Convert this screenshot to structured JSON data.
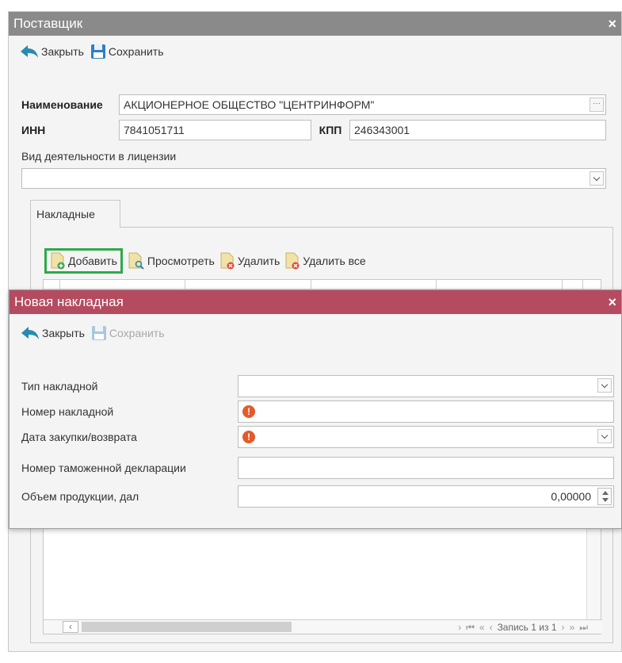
{
  "supplier_window": {
    "title": "Поставщик",
    "close_glyph": "×",
    "toolbar": {
      "close_label": "Закрыть",
      "save_label": "Сохранить"
    },
    "fields": {
      "name_label": "Наименование",
      "name_value": "АКЦИОНЕРНОЕ ОБЩЕСТВО \"ЦЕНТРИНФОРМ\"",
      "inn_label": "ИНН",
      "inn_value": "7841051711",
      "kpp_label": "КПП",
      "kpp_value": "246343001",
      "activity_label": "Вид деятельности в лицензии",
      "activity_value": ""
    },
    "tab_label": "Накладные",
    "grid_toolbar": {
      "add_label": "Добавить",
      "view_label": "Просмотреть",
      "delete_label": "Удалить",
      "delete_all_label": "Удалить все"
    },
    "pager": {
      "record_text": "Запись 1 из 1"
    }
  },
  "invoice_dialog": {
    "title": "Новая накладная",
    "close_glyph": "×",
    "toolbar": {
      "close_label": "Закрыть",
      "save_label": "Сохранить"
    },
    "fields": {
      "type_label": "Тип накладной",
      "number_label": "Номер накладной",
      "date_label": "Дата закупки/возврата",
      "customs_label": "Номер таможенной декларации",
      "volume_label": "Объем продукции, дал",
      "volume_value": "0,00000"
    }
  },
  "colors": {
    "supplier_title_bg": "#8a8a8a",
    "dialog_title_bg": "#b44b5f",
    "add_highlight": "#2ea94a",
    "warning": "#e55a2b",
    "back_arrow": "#2a8ab0"
  },
  "icons": [
    "back-arrow-icon",
    "floppy-save-icon",
    "doc-add-icon",
    "doc-view-icon",
    "doc-delete-icon",
    "warning-icon"
  ]
}
